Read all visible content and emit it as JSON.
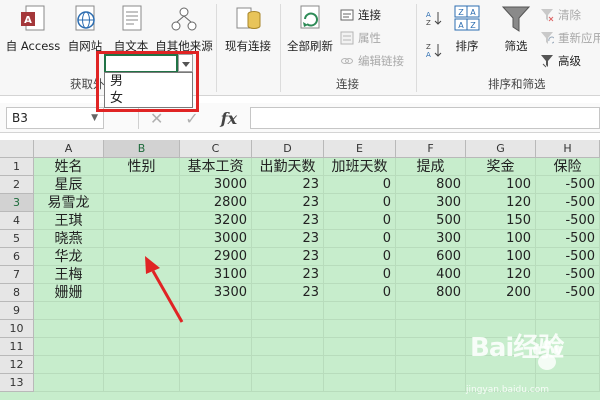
{
  "ribbon": {
    "get_external": {
      "buttons": [
        {
          "label": "自 Access",
          "icon": "access-icon"
        },
        {
          "label": "自网站",
          "icon": "web-icon"
        },
        {
          "label": "自文本",
          "icon": "text-file-icon"
        },
        {
          "label": "自其他来源",
          "icon": "other-sources-icon"
        }
      ],
      "group_label": "获取外部数据"
    },
    "existing_connections": {
      "label": "现有连接",
      "icon": "existing-connections-icon"
    },
    "connections": {
      "refresh_all": "全部刷新",
      "connect": "连接",
      "properties": "属性",
      "edit_links": "编辑链接",
      "group_label": "连接"
    },
    "sort_filter": {
      "sort": "排序",
      "filter": "筛选",
      "clear": "清除",
      "reapply": "重新应用",
      "advanced": "高级",
      "group_label": "排序和筛选"
    }
  },
  "formula_bar": {
    "name_box": "B3",
    "fx": "fx",
    "formula": ""
  },
  "sheet": {
    "columns": [
      "A",
      "B",
      "C",
      "D",
      "E",
      "F",
      "G",
      "H"
    ],
    "selected_column": "B",
    "rows": [
      "1",
      "2",
      "3",
      "4",
      "5",
      "6",
      "7",
      "8",
      "9",
      "10",
      "11",
      "12",
      "13"
    ],
    "selected_row": "3",
    "headers": [
      "姓名",
      "性别",
      "基本工资",
      "出勤天数",
      "加班天数",
      "提成",
      "奖金",
      "保险"
    ],
    "data": [
      [
        "星辰",
        "",
        "3000",
        "23",
        "0",
        "800",
        "100",
        "-500"
      ],
      [
        "易雪龙",
        "",
        "2800",
        "23",
        "0",
        "300",
        "120",
        "-500"
      ],
      [
        "王琪",
        "",
        "3200",
        "23",
        "0",
        "500",
        "150",
        "-500"
      ],
      [
        "晓燕",
        "",
        "3000",
        "23",
        "0",
        "300",
        "100",
        "-500"
      ],
      [
        "华龙",
        "",
        "2900",
        "23",
        "0",
        "600",
        "100",
        "-500"
      ],
      [
        "王梅",
        "",
        "3100",
        "23",
        "0",
        "400",
        "120",
        "-500"
      ],
      [
        "姗姗",
        "",
        "3300",
        "23",
        "0",
        "800",
        "200",
        "-500"
      ]
    ],
    "dropdown_options": [
      "男",
      "女"
    ]
  },
  "watermark": {
    "text": "Bai经验",
    "sub": "jingyan.baidu.com"
  },
  "colors": {
    "sheet_bg": "#c7edcc",
    "accent_green": "#217346",
    "annotation_red": "#e02424"
  }
}
